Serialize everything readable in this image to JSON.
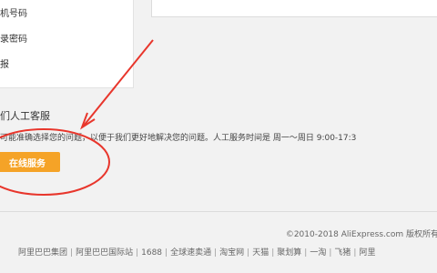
{
  "menu": {
    "items": [
      {
        "label": "机号码"
      },
      {
        "label": "录密码"
      },
      {
        "label": "报"
      }
    ]
  },
  "support": {
    "title": "们人工客服",
    "description": "可能准确选择您的问题，以便于我们更好地解决您的问题。人工服务时间是 周一～周日 9:00-17:3",
    "button_label": "在线服务"
  },
  "footer": {
    "copyright": "©2010-2018 AliExpress.com 版权所有",
    "links": [
      "阿里巴巴集团",
      "阿里巴巴国际站",
      "1688",
      "全球速卖通",
      "淘宝网",
      "天猫",
      "聚划算",
      "一淘",
      "飞猪",
      "阿里"
    ]
  },
  "annotation": {
    "color": "#e8362c"
  }
}
